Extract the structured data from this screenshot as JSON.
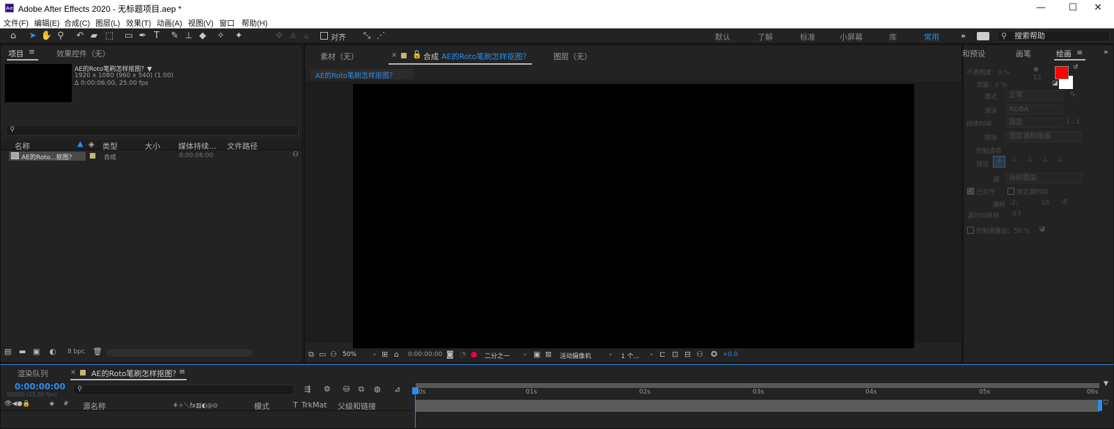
{
  "window": {
    "app_icon": "Ae",
    "title": "Adobe After Effects 2020 - 无标题项目.aep *",
    "controls": [
      "—",
      "☐",
      "✕"
    ]
  },
  "menu": [
    "文件(F)",
    "编辑(E)",
    "合成(C)",
    "图层(L)",
    "效果(T)",
    "动画(A)",
    "视图(V)",
    "窗口",
    "帮助(H)"
  ],
  "toolbar": {
    "align_label": "对齐",
    "workspaces": [
      "默认",
      "了解",
      "标准",
      "小屏幕",
      "库",
      "常用"
    ],
    "active_workspace": "常用",
    "more": "»",
    "help_search_placeholder": "搜索帮助"
  },
  "project_panel": {
    "tabs": [
      "项目",
      "效果控件（无）"
    ],
    "menu_icon": "≡",
    "item_name": "AE的Roto笔刷怎样抠图？▼",
    "item_info_1": "1920 x 1080  (960 x 540) (1.00)",
    "item_info_2": "Δ 0:00:06:00, 25.00 fps",
    "search_placeholder": "",
    "columns": [
      "名称",
      "类型",
      "大小",
      "媒体持续...",
      "文件路径"
    ],
    "rows": [
      {
        "name": "AE的Roto...抠图？",
        "type": "合成",
        "size": "",
        "duration": "0:00:06:00",
        "path": ""
      }
    ],
    "bpc": "8 bpc"
  },
  "viewer_panel": {
    "tabs": [
      "素材（无）",
      "合成",
      "AE的Roto笔刷怎样抠图？",
      "图层（无）"
    ],
    "close_glyph": "×",
    "breadcrumb": "AE的Roto笔刷怎样抠图？",
    "zoom": "50%",
    "timecode": "0:00:00:00",
    "resolution": "二分之一",
    "camera": "活动摄像机",
    "views": "1 个...",
    "exposure": "+0.0"
  },
  "right_panel": {
    "tabs": [
      "和预设",
      "画笔",
      "绘画"
    ],
    "menu_icon": "≡",
    "more": "»",
    "opacity": "不透明度：0 %",
    "flow": "流量：0 %",
    "mode_label": "模式",
    "mode_value": "正常",
    "channel_label": "通道",
    "channel_value": "RGBA",
    "duration_label": "持续时间",
    "duration_value": "固定",
    "erase_label": "擦除",
    "erase_value": "图层源和绘画",
    "clone_options": "仿制选项",
    "preset_label": "预设",
    "source_label": "源",
    "source_value": "当前图层",
    "aligned": "已对齐",
    "lock_time": "锁定源时间",
    "offset_label": "偏移",
    "offset_x": "-2,",
    "offset_y": "16",
    "source_time": "源时间转移",
    "source_time_value": "0 f",
    "clone_overlay": "仿制源叠加：50 %",
    "ratio": "1 : 1",
    "num_13": "13",
    "fg_color": "#ff0000",
    "bg_color": "#ffffff"
  },
  "timeline": {
    "tabs": [
      "渲染队列",
      "AE的Roto笔刷怎样抠图？"
    ],
    "close_glyph": "×",
    "menu_icon": "≡",
    "timecode": "0:00:00:00",
    "fps": "00000 (25.00 fps)",
    "columns": [
      "源名称",
      "模式",
      "T",
      "TrkMat",
      "父级和链接"
    ],
    "num_col": "#",
    "ruler": [
      "0s",
      "01s",
      "02s",
      "03s",
      "04s",
      "05s",
      "06s"
    ]
  }
}
